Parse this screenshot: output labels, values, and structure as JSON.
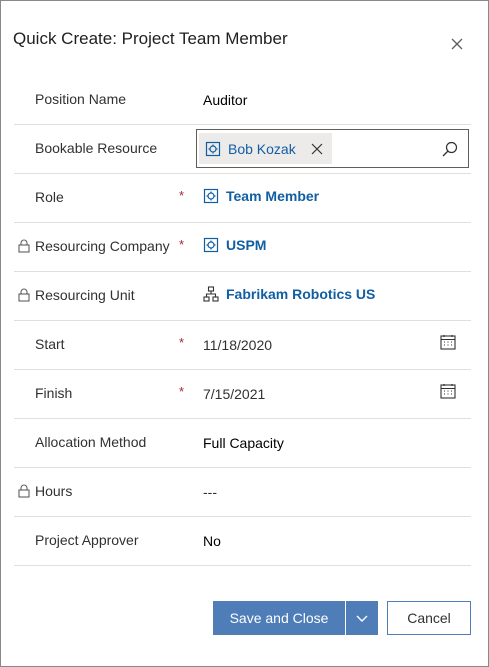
{
  "dialog": {
    "title": "Quick Create: Project Team Member",
    "close_icon": "close-icon"
  },
  "fields": {
    "position_name": {
      "label": "Position Name",
      "value": "Auditor"
    },
    "bookable_resource": {
      "label": "Bookable Resource",
      "value": "Bob Kozak",
      "icon": "resource-icon"
    },
    "role": {
      "label": "Role",
      "required": "*",
      "value": "Team Member",
      "icon": "resource-icon"
    },
    "resourcing_company": {
      "label": "Resourcing Company",
      "required": "*",
      "value": "USPM",
      "locked": true,
      "icon": "resource-icon"
    },
    "resourcing_unit": {
      "label": "Resourcing Unit",
      "value": "Fabrikam Robotics US",
      "locked": true,
      "icon": "org-unit-icon"
    },
    "start": {
      "label": "Start",
      "required": "*",
      "value": "11/18/2020",
      "icon": "calendar-icon"
    },
    "finish": {
      "label": "Finish",
      "required": "*",
      "value": "7/15/2021",
      "icon": "calendar-icon"
    },
    "allocation_method": {
      "label": "Allocation Method",
      "value": "Full Capacity"
    },
    "hours": {
      "label": "Hours",
      "value": "---",
      "locked": true
    },
    "project_approver": {
      "label": "Project Approver",
      "value": "No"
    }
  },
  "footer": {
    "save_label": "Save and Close",
    "cancel_label": "Cancel"
  },
  "colors": {
    "primary": "#4e7db8",
    "link": "#115ea3",
    "required": "#a4262c",
    "divider": "#e1dfdd"
  }
}
